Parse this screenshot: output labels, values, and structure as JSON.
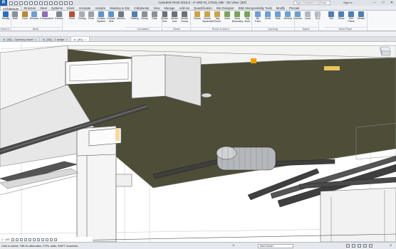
{
  "app": {
    "logo": "R",
    "title": "Autodesk Revit 2018.2 - K-1RE-M_17618_MB - 3D View: {3D}",
    "search_placeholder": "Type a keyword or phrase",
    "sign_in": "Sign In",
    "window_buttons": [
      "–",
      "□",
      "✕"
    ]
  },
  "qat_icons": [
    "open-icon",
    "save-icon",
    "sync-icon",
    "undo-icon",
    "redo-icon",
    "print-icon",
    "measure-icon",
    "dimension-icon",
    "tag-icon",
    "3d-view-icon",
    "section-icon",
    "thin-lines-icon",
    "close-hidden-icon"
  ],
  "tabs": [
    "Architecture",
    "Structure",
    "Steel",
    "Systems",
    "Insert",
    "Annotate",
    "Analyze",
    "Massing & Site",
    "Collaborate",
    "View",
    "Manage",
    "Add-Ins",
    "Quantification",
    "Site Designer",
    "BIM Interoperability Tools",
    "Modify",
    "Precast"
  ],
  "active_tab": "Architecture",
  "ribbon": {
    "tools": [
      {
        "label": "Modify",
        "icon": "modify-icon",
        "color": "#2c6fb7"
      },
      {
        "label": "Wall",
        "icon": "wall-icon",
        "color": "#8a9099"
      },
      {
        "label": "Door",
        "icon": "door-icon",
        "color": "#b9872f"
      },
      {
        "label": "Window",
        "icon": "window-icon",
        "color": "#6d9fd1"
      },
      {
        "label": "Component",
        "icon": "component-icon",
        "color": "#8f6bb3"
      },
      {
        "label": "Column",
        "icon": "column-icon",
        "color": "#7d858f"
      },
      {
        "label": "Roof",
        "icon": "roof-icon",
        "color": "#b0513a"
      },
      {
        "label": "Ceiling",
        "icon": "ceiling-icon",
        "color": "#a7adb5"
      },
      {
        "label": "Floor",
        "icon": "floor-icon",
        "color": "#9aa1a9"
      },
      {
        "label": "Curtain\nSystem",
        "icon": "curtain-system-icon",
        "color": "#5c93c9"
      },
      {
        "label": "Curtain\nGrid",
        "icon": "curtain-grid-icon",
        "color": "#5c93c9"
      },
      {
        "label": "Mullion",
        "icon": "mullion-icon",
        "color": "#6f7780"
      },
      {
        "label": "Railing",
        "icon": "railing-icon",
        "color": "#4f7fb3"
      },
      {
        "label": "Ramp",
        "icon": "ramp-icon",
        "color": "#8a9099"
      },
      {
        "label": "Stair",
        "icon": "stair-icon",
        "color": "#8a9099"
      },
      {
        "label": "Model\nText",
        "icon": "model-text-icon",
        "color": "#6a7079"
      },
      {
        "label": "Model\nLine",
        "icon": "model-line-icon",
        "color": "#6a7079"
      },
      {
        "label": "Model\nGroup",
        "icon": "model-group-icon",
        "color": "#6a7079"
      },
      {
        "label": "Room",
        "icon": "room-icon",
        "color": "#c9a24a"
      },
      {
        "label": "Room\nSeparator",
        "icon": "room-separator-icon",
        "color": "#c9a24a"
      },
      {
        "label": "Tag\nRoom",
        "icon": "tag-room-icon",
        "color": "#c9a24a"
      },
      {
        "label": "Area",
        "icon": "area-icon",
        "color": "#79a35c"
      },
      {
        "label": "Area\nBoundary",
        "icon": "area-boundary-icon",
        "color": "#79a35c"
      },
      {
        "label": "Tag\nArea",
        "icon": "tag-area-icon",
        "color": "#79a35c"
      },
      {
        "label": "By\nFace",
        "icon": "by-face-icon",
        "color": "#6d9fd1"
      },
      {
        "label": "Shaft",
        "icon": "shaft-icon",
        "color": "#6d9fd1"
      },
      {
        "label": "Wall",
        "icon": "opening-wall-icon",
        "color": "#6d9fd1"
      },
      {
        "label": "Vertical",
        "icon": "vertical-icon",
        "color": "#6d9fd1"
      },
      {
        "label": "Dormer",
        "icon": "dormer-icon",
        "color": "#6d9fd1"
      },
      {
        "label": "Level",
        "icon": "level-icon",
        "color": "#b5b9bf"
      },
      {
        "label": "Grid",
        "icon": "grid-icon",
        "color": "#b5b9bf"
      },
      {
        "label": "Set",
        "icon": "set-icon",
        "color": "#4f7fb3"
      },
      {
        "label": "Show",
        "icon": "show-icon",
        "color": "#4f7fb3"
      },
      {
        "label": "Ref\nPlane",
        "icon": "ref-plane-icon",
        "color": "#4f7fb3"
      },
      {
        "label": "Viewer",
        "icon": "viewer-icon",
        "color": "#4f7fb3"
      }
    ],
    "groups": [
      "Select ▾",
      "Build",
      "Circulation",
      "Model",
      "Room & Area ▾",
      "Opening",
      "Datum",
      "Work Plane"
    ]
  },
  "doc_tabs": [
    {
      "label": "{3D} - Opening Insert",
      "active": false
    },
    {
      "label": "{3D} - 1 kellari",
      "active": false
    },
    {
      "label": "{3D}",
      "active": true
    }
  ],
  "view_control": {
    "scale": "1 : 100"
  },
  "status": {
    "text": "Click to select, TAB for alternates, CTRL adds, SHIFT unselects.",
    "zero": ":0",
    "model_value": "Main Model",
    "filter": ":0"
  },
  "colors": {
    "slab": "#4e4d38",
    "accent": "#f0a000",
    "selection": "#2c6fb7"
  }
}
